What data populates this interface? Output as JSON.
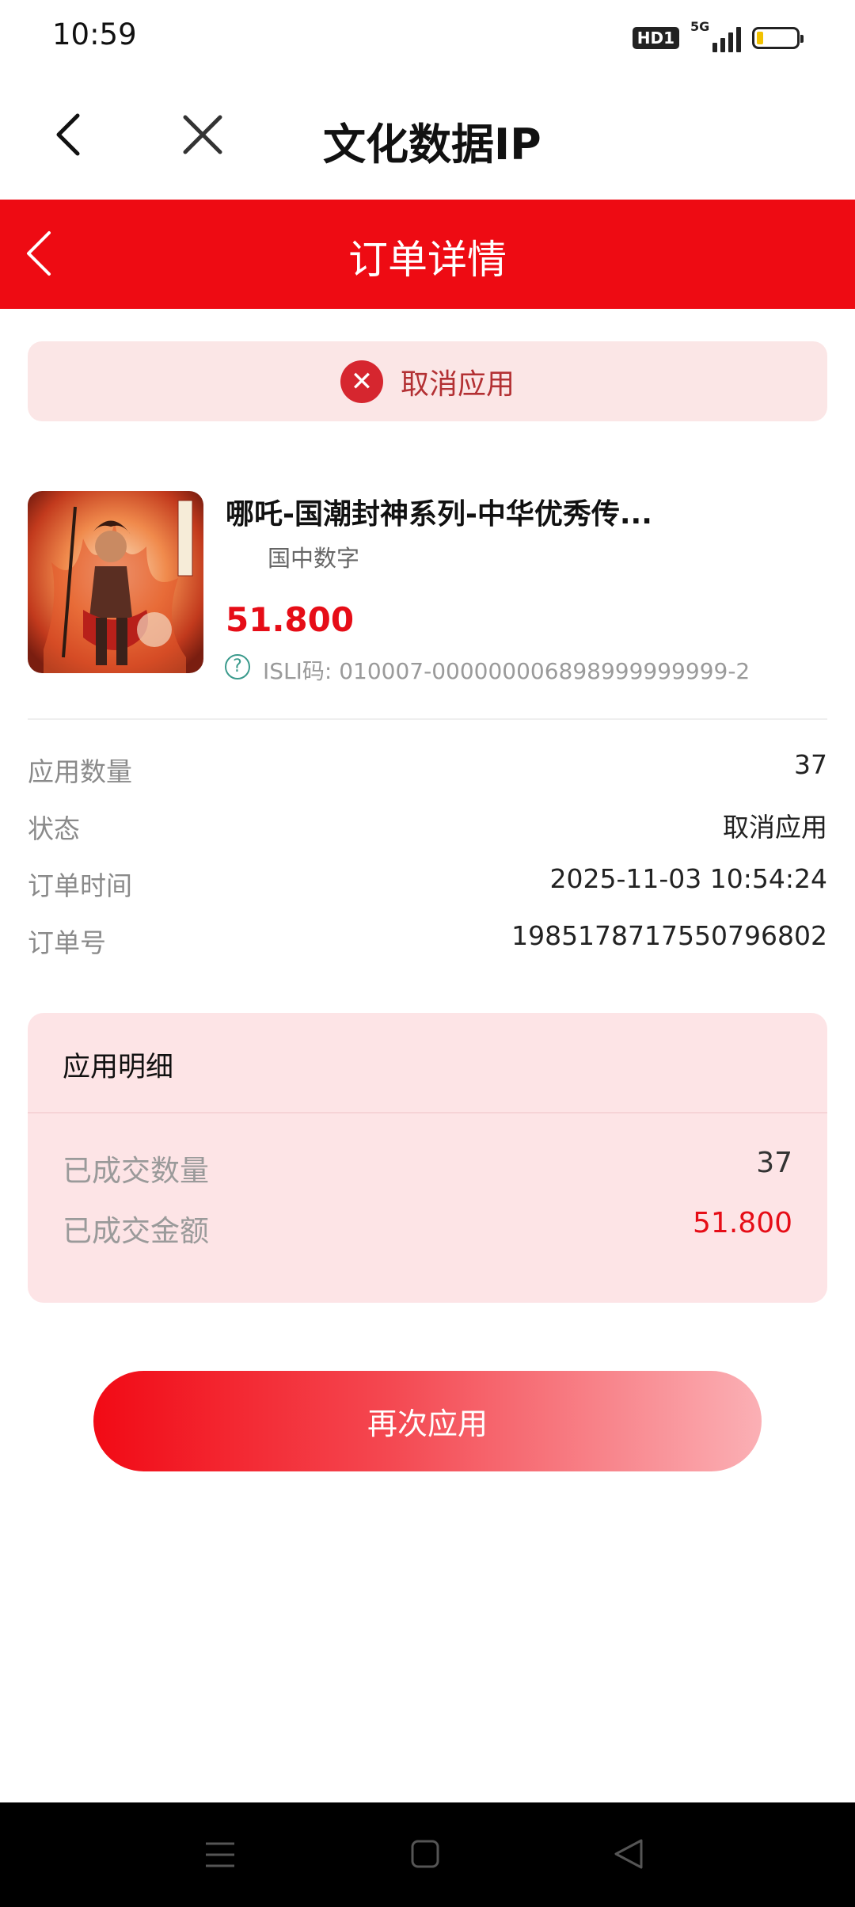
{
  "status_bar": {
    "time": "10:59",
    "hd_badge": "HD1",
    "network": "5G",
    "battery_level": 0.15
  },
  "browser": {
    "title": "文化数据IP"
  },
  "header": {
    "title": "订单详情"
  },
  "order_status_banner": {
    "text": "取消应用",
    "icon": "close-circle-icon",
    "color": "#d6262f"
  },
  "product": {
    "name": "哪吒-国潮封神系列-中华优秀传...",
    "issuer": "国中数字",
    "price": "51.800",
    "isli": "ISLI码: 010007-000000006898999999999-2"
  },
  "order_info": [
    {
      "label": "应用数量",
      "value": "37"
    },
    {
      "label": "状态",
      "value": "取消应用"
    },
    {
      "label": "订单时间",
      "value": "2025-11-03 10:54:24"
    },
    {
      "label": "订单号",
      "value": "1985178717550796802"
    }
  ],
  "detail": {
    "title": "应用明细",
    "rows": [
      {
        "label": "已成交数量",
        "value": "37"
      },
      {
        "label": "已成交金额",
        "value": "51.800"
      }
    ]
  },
  "action": {
    "reapply_label": "再次应用"
  },
  "colors": {
    "brand_red": "#ee0b13",
    "price_red": "#e60d17",
    "banner_bg": "#fbe6e6",
    "card_bg": "#fde4e6"
  }
}
